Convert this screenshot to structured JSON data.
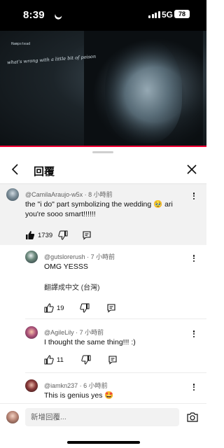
{
  "status_bar": {
    "time": "8:39",
    "network": "5G",
    "battery": "78"
  },
  "video": {
    "caption": "Hampstead",
    "lyric": "what's wrong with a little bit of poison"
  },
  "sheet": {
    "title": "回覆"
  },
  "parent_comment": {
    "author": "@CamilaAraujo-w5x",
    "time": "8 小時前",
    "text": "the \"i do\" part symbolizing the wedding 🥹 ari you're sooo smart!!!!!!",
    "likes": "1739"
  },
  "replies": [
    {
      "author": "@gutslorerush",
      "time": "7 小時前",
      "text": "OMG YESSS",
      "translate": "翻譯成中文 (台灣)",
      "likes": "19"
    },
    {
      "author": "@AgileLily",
      "time": "7 小時前",
      "text": "I thought the same thing!!! :)",
      "likes": "11"
    },
    {
      "author": "@iamkn237",
      "time": "6 小時前",
      "text": "This is genius yes 🤩"
    }
  ],
  "composer": {
    "placeholder": "新增回覆..."
  },
  "icons": {
    "back": "chevron-left-icon",
    "close": "close-icon",
    "more": "more-vertical-icon",
    "like": "thumbs-up-icon",
    "dislike": "thumbs-down-icon",
    "reply": "reply-icon",
    "camera": "camera-icon"
  },
  "colors": {
    "accent": "#ff0033",
    "highlight_bg": "#f2f2f2",
    "secondary_text": "#606060"
  }
}
